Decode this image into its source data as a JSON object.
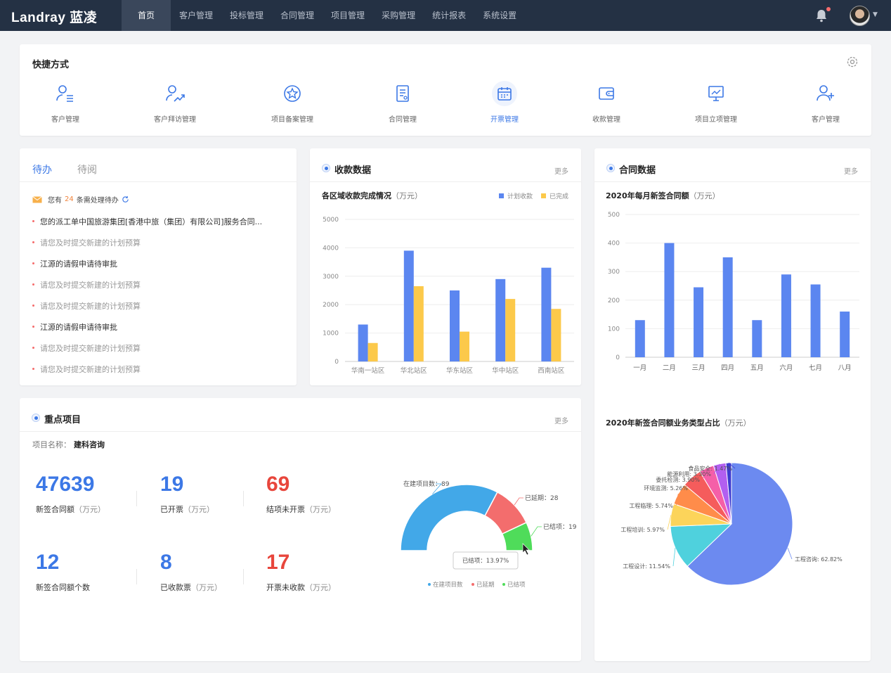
{
  "app": {
    "logo": "Landray 蓝凌"
  },
  "nav": {
    "items": [
      "首页",
      "客户管理",
      "投标管理",
      "合同管理",
      "项目管理",
      "采购管理",
      "统计报表",
      "系统设置"
    ],
    "active_index": 0
  },
  "header": {
    "notifications_icon": "bell-icon",
    "avatar": "user-avatar"
  },
  "quick": {
    "title": "快捷方式",
    "settings_icon": "gear-icon",
    "items": [
      {
        "label": "客户管理",
        "icon": "user-list-icon"
      },
      {
        "label": "客户拜访管理",
        "icon": "user-trend-icon"
      },
      {
        "label": "项目备案管理",
        "icon": "star-circle-icon"
      },
      {
        "label": "合同管理",
        "icon": "document-icon"
      },
      {
        "label": "开票管理",
        "icon": "calendar-icon",
        "active": true
      },
      {
        "label": "收款管理",
        "icon": "wallet-icon"
      },
      {
        "label": "项目立项管理",
        "icon": "presentation-icon"
      },
      {
        "label": "客户管理",
        "icon": "add-user-icon"
      }
    ]
  },
  "todo": {
    "tabs": [
      "待办",
      "待阅"
    ],
    "summary_prefix": "您有",
    "count": "24",
    "summary_suffix": "条需处理待办",
    "items": [
      {
        "text": "您的派工单中国旅游集团[香港中旅（集团）有限公司]服务合同...",
        "read": false
      },
      {
        "text": "请您及时提交新建的计划预算",
        "read": true
      },
      {
        "text": "江源的请假申请待审批",
        "read": false
      },
      {
        "text": "请您及时提交新建的计划预算",
        "read": true
      },
      {
        "text": "请您及时提交新建的计划预算",
        "read": true
      },
      {
        "text": "江源的请假申请待审批",
        "read": false
      },
      {
        "text": "请您及时提交新建的计划预算",
        "read": true
      },
      {
        "text": "请您及时提交新建的计划预算",
        "read": true
      }
    ]
  },
  "collect": {
    "title": "收款数据",
    "more": "更多",
    "subtitle": "各区域收款完成情况",
    "unit": "（万元）"
  },
  "contract": {
    "title": "合同数据",
    "more": "更多",
    "subtitle": "2020年每月新签合同额",
    "unit": "（万元）",
    "pie_subtitle": "2020年新签合同额业务类型占比",
    "pie_unit": "（万元）"
  },
  "key": {
    "title": "重点项目",
    "more": "更多",
    "project_label": "项目名称：",
    "project_name": "建科咨询",
    "stats": [
      {
        "value": "47639",
        "label": "新签合同额",
        "unit": "（万元）",
        "color": "#3c78e6"
      },
      {
        "value": "19",
        "label": "已开票",
        "unit": "（万元）",
        "color": "#3c78e6"
      },
      {
        "value": "69",
        "label": "结项未开票",
        "unit": "（万元）",
        "color": "#e8463c"
      },
      {
        "value": "12",
        "label": "新签合同额个数",
        "unit": "",
        "color": "#3c78e6"
      },
      {
        "value": "8",
        "label": "已收款票",
        "unit": "（万元）",
        "color": "#3c78e6"
      },
      {
        "value": "17",
        "label": "开票未收款",
        "unit": "（万元）",
        "color": "#e8463c"
      }
    ]
  },
  "chart_data": [
    {
      "type": "bar",
      "categories": [
        "华南一站区",
        "华北站区",
        "华东站区",
        "华中站区",
        "西南站区"
      ],
      "series": [
        {
          "name": "计划收款",
          "values": [
            1300,
            3900,
            2500,
            2900,
            3300
          ],
          "color": "#5b86f0"
        },
        {
          "name": "已完成",
          "values": [
            650,
            2650,
            1050,
            2200,
            1850
          ],
          "color": "#fcc94a"
        }
      ],
      "ylim": [
        0,
        5000
      ],
      "yticks": [
        0,
        1000,
        2000,
        3000,
        4000,
        5000
      ],
      "grid": true,
      "legend": "top-right"
    },
    {
      "type": "bar",
      "categories": [
        "一月",
        "二月",
        "三月",
        "四月",
        "五月",
        "六月",
        "七月",
        "八月"
      ],
      "series": [
        {
          "values": [
            130,
            400,
            245,
            350,
            130,
            290,
            255,
            160
          ],
          "color": "#5b86f0"
        }
      ],
      "ylim": [
        0,
        500
      ],
      "yticks": [
        0,
        100,
        200,
        300,
        400,
        500
      ],
      "grid": true
    },
    {
      "type": "pie",
      "slices": [
        {
          "label": "工程咨询: 62.82%",
          "value": 62.82,
          "color": "#6c8af0"
        },
        {
          "label": "工程设计: 11.54%",
          "value": 11.54,
          "color": "#4fd1dd"
        },
        {
          "label": "工程培训: 5.97%",
          "value": 5.97,
          "color": "#fcd45a"
        },
        {
          "label": "工程临理: 5.74%",
          "value": 5.74,
          "color": "#ff8c4a"
        },
        {
          "label": "环境监测: 5.26%",
          "value": 5.26,
          "color": "#f55c5c"
        },
        {
          "label": "委托检测: 3.90%",
          "value": 3.9,
          "color": "#f55fa8"
        },
        {
          "label": "能源利用: 3.30%",
          "value": 3.3,
          "color": "#b25ff0"
        },
        {
          "label": "食品安全: 1.47%",
          "value": 1.47,
          "color": "#3d3bd0"
        }
      ]
    },
    {
      "type": "pie",
      "style": "half-donut",
      "slices": [
        {
          "label": "在建项目数",
          "value": 89,
          "color": "#42a8e8"
        },
        {
          "label": "已延期",
          "value": 28,
          "color": "#f36d6d"
        },
        {
          "label": "已结项",
          "value": 19,
          "color": "#4fdc5a"
        }
      ],
      "tooltip": "已结项：13.97%",
      "legend": "bottom"
    }
  ]
}
